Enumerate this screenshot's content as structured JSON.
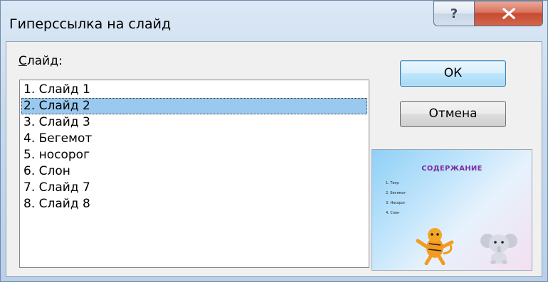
{
  "window": {
    "title": "Гиперссылка на слайд",
    "help_button": "?",
    "close_button": "✕"
  },
  "list": {
    "label_prefix": "С",
    "label_rest": "лайд:",
    "items": [
      {
        "label": "1. Слайд 1"
      },
      {
        "label": "2. Слайд 2",
        "selected": true
      },
      {
        "label": "3. Слайд 3"
      },
      {
        "label": "4. Бегемот"
      },
      {
        "label": "5. носорог"
      },
      {
        "label": "6. Слон"
      },
      {
        "label": "7. Слайд 7"
      },
      {
        "label": "8. Слайд 8"
      }
    ]
  },
  "buttons": {
    "ok": "ОК",
    "cancel": "Отмена"
  },
  "preview": {
    "title": "СОДЕРЖАНИЕ",
    "items": [
      "1. Тигр",
      "2. Бегемот",
      "3. Носорог",
      "4. Слон"
    ]
  }
}
